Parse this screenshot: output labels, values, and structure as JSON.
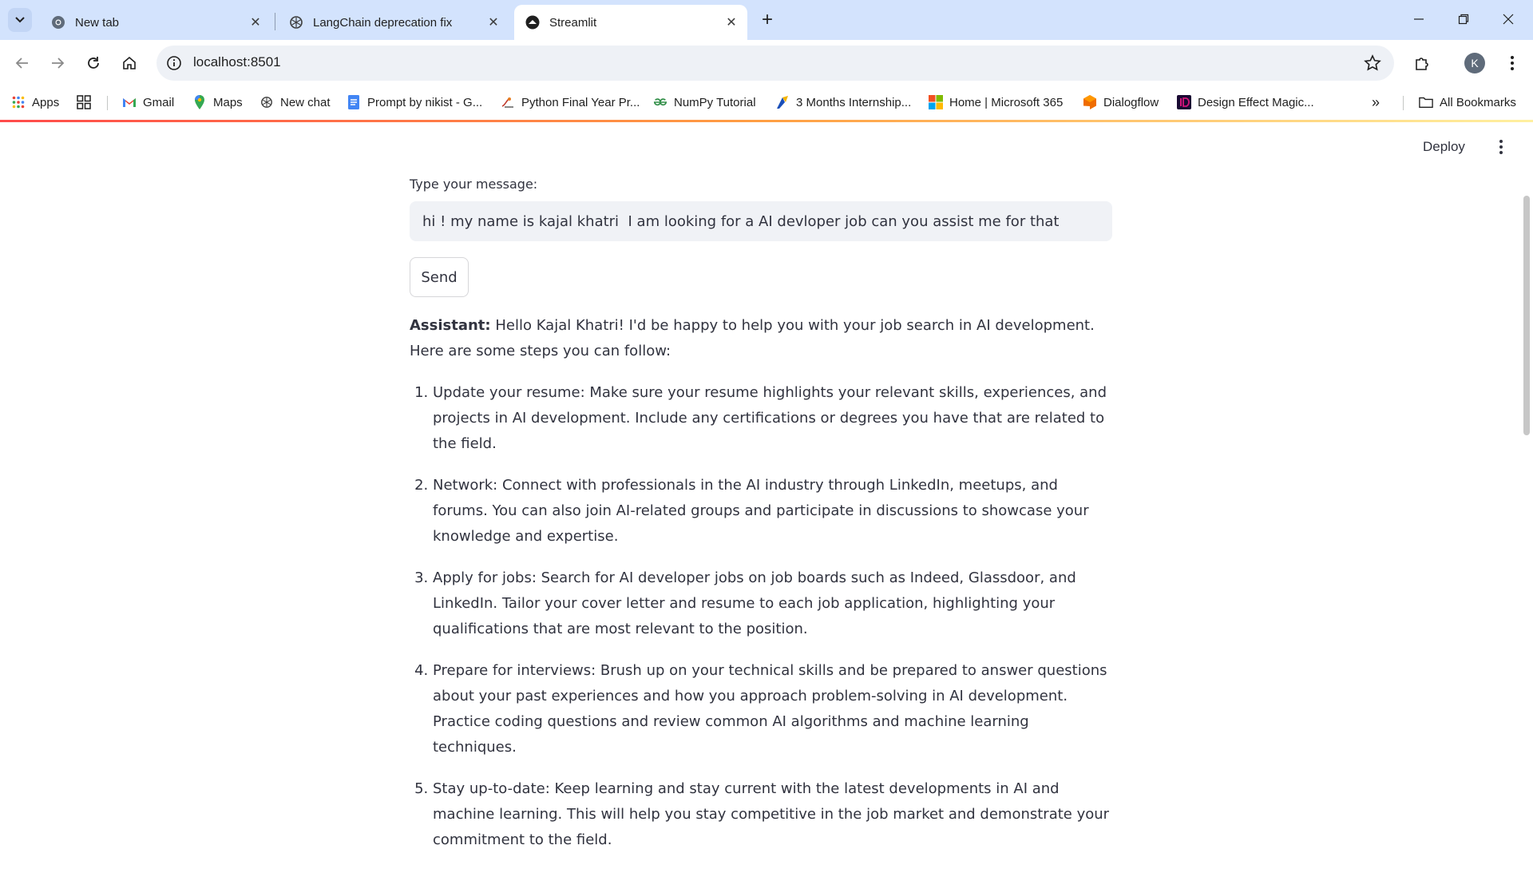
{
  "browser": {
    "tabs": [
      {
        "title": "New tab",
        "icon": "chrome-icon"
      },
      {
        "title": "LangChain deprecation fix",
        "icon": "openai-icon"
      },
      {
        "title": "Streamlit",
        "icon": "streamlit-icon",
        "active": true
      }
    ],
    "url": "localhost:8501",
    "profile_initial": "K",
    "bookmarks": [
      {
        "label": "Apps",
        "icon": "apps-grid-icon"
      },
      {
        "label": "Gmail",
        "icon": "gmail-icon"
      },
      {
        "label": "Maps",
        "icon": "maps-icon"
      },
      {
        "label": "New chat",
        "icon": "openai-icon"
      },
      {
        "label": "Prompt by nikist - G...",
        "icon": "docs-icon"
      },
      {
        "label": "Python Final Year Pr...",
        "icon": "site-icon"
      },
      {
        "label": "NumPy Tutorial",
        "icon": "gfg-icon"
      },
      {
        "label": "3 Months Internship...",
        "icon": "internship-icon"
      },
      {
        "label": "Home | Microsoft 365",
        "icon": "microsoft-icon"
      },
      {
        "label": "Dialogflow",
        "icon": "dialogflow-icon"
      },
      {
        "label": "Design Effect Magic...",
        "icon": "design-icon"
      }
    ],
    "all_bookmarks": "All Bookmarks"
  },
  "app": {
    "deploy_label": "Deploy",
    "input_label": "Type your message:",
    "input_value": "hi ! my name is kajal khatri  I am looking for a AI devloper job can you assist me for that",
    "send_label": "Send",
    "assistant_prefix": "Assistant:",
    "assistant_intro": " Hello Kajal Khatri! I'd be happy to help you with your job search in AI development. Here are some steps you can follow:",
    "steps": [
      "Update your resume: Make sure your resume highlights your relevant skills, experiences, and projects in AI development. Include any certifications or degrees you have that are related to the field.",
      "Network: Connect with professionals in the AI industry through LinkedIn, meetups, and forums. You can also join AI-related groups and participate in discussions to showcase your knowledge and expertise.",
      "Apply for jobs: Search for AI developer jobs on job boards such as Indeed, Glassdoor, and LinkedIn. Tailor your cover letter and resume to each job application, highlighting your qualifications that are most relevant to the position.",
      "Prepare for interviews: Brush up on your technical skills and be prepared to answer questions about your past experiences and how you approach problem-solving in AI development. Practice coding questions and review common AI algorithms and machine learning techniques.",
      "Stay up-to-date: Keep learning and stay current with the latest developments in AI and machine learning. This will help you stay competitive in the job market and demonstrate your commitment to the field."
    ]
  }
}
